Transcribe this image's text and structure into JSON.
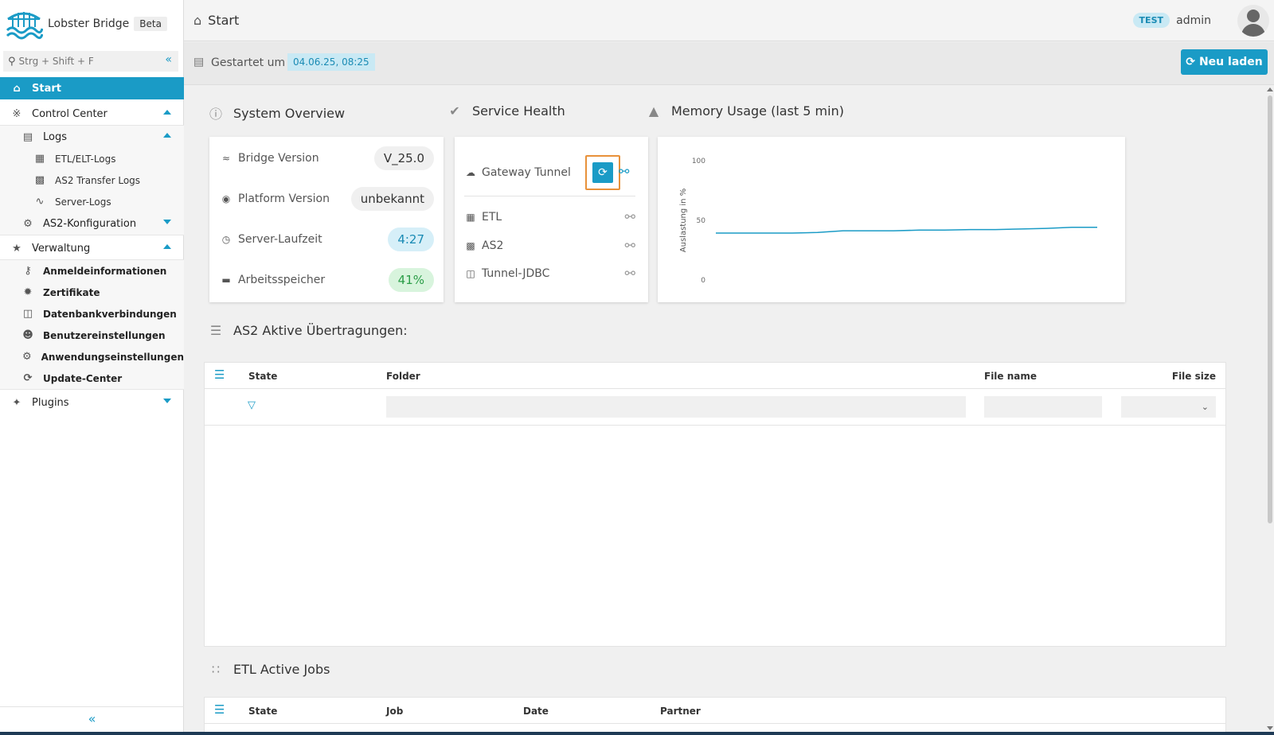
{
  "brand": {
    "name": "Lobster Bridge",
    "badge": "Beta"
  },
  "search": {
    "placeholder": "Strg + Shift + F"
  },
  "sidebar": {
    "start": "Start",
    "control_center": "Control Center",
    "logs": "Logs",
    "etl_logs": "ETL/ELT-Logs",
    "as2_logs": "AS2 Transfer Logs",
    "server_logs": "Server-Logs",
    "as2_config": "AS2-Konfiguration",
    "verwaltung": "Verwaltung",
    "anmelde": "Anmeldeinformationen",
    "zertifikate": "Zertifikate",
    "datenbank": "Datenbankverbindungen",
    "benutzer": "Benutzereinstellungen",
    "anwendung": "Anwendungseinstellungen",
    "update": "Update-Center",
    "plugins": "Plugins"
  },
  "topbar": {
    "title": "Start",
    "env": "TEST",
    "user": "admin"
  },
  "subbar": {
    "started_label": "Gestartet um",
    "started_value": "04.06.25, 08:25",
    "reload": "Neu laden"
  },
  "system_overview": {
    "title": "System Overview",
    "bridge_label": "Bridge Version",
    "bridge_value": "V_25.0",
    "platform_label": "Platform Version",
    "platform_value": "unbekannt",
    "uptime_label": "Server-Laufzeit",
    "uptime_value": "4:27",
    "memory_label": "Arbeitsspeicher",
    "memory_value": "41%"
  },
  "service_health": {
    "title": "Service Health",
    "gateway": "Gateway Tunnel",
    "etl": "ETL",
    "as2": "AS2",
    "jdbc": "Tunnel-JDBC"
  },
  "memory_usage": {
    "title": "Memory Usage (last 5 min)",
    "ylabel": "Auslastung in %",
    "ticks": [
      "100",
      "50",
      "0"
    ]
  },
  "chart_data": {
    "type": "line",
    "ylabel": "Auslastung in %",
    "ylim": [
      0,
      100
    ],
    "y_ticks": [
      0,
      50,
      100
    ],
    "grid": false,
    "series": [
      {
        "values": [
          37,
          37,
          37,
          37,
          37.5,
          39,
          39,
          39,
          39.5,
          39.5,
          40,
          40,
          40.5,
          41,
          42,
          42
        ]
      }
    ],
    "line_color": "#1a9bc6"
  },
  "as2_table": {
    "title": "AS2 Aktive Übertragungen:",
    "col_state": "State",
    "col_folder": "Folder",
    "col_filename": "File name",
    "col_filesize": "File size"
  },
  "etl_table": {
    "title": "ETL Active Jobs",
    "col_state": "State",
    "col_job": "Job",
    "col_date": "Date",
    "col_partner": "Partner"
  },
  "colors": {
    "accent": "#1a9bc6",
    "highlight": "#e8913a",
    "success": "#2a9d47"
  }
}
